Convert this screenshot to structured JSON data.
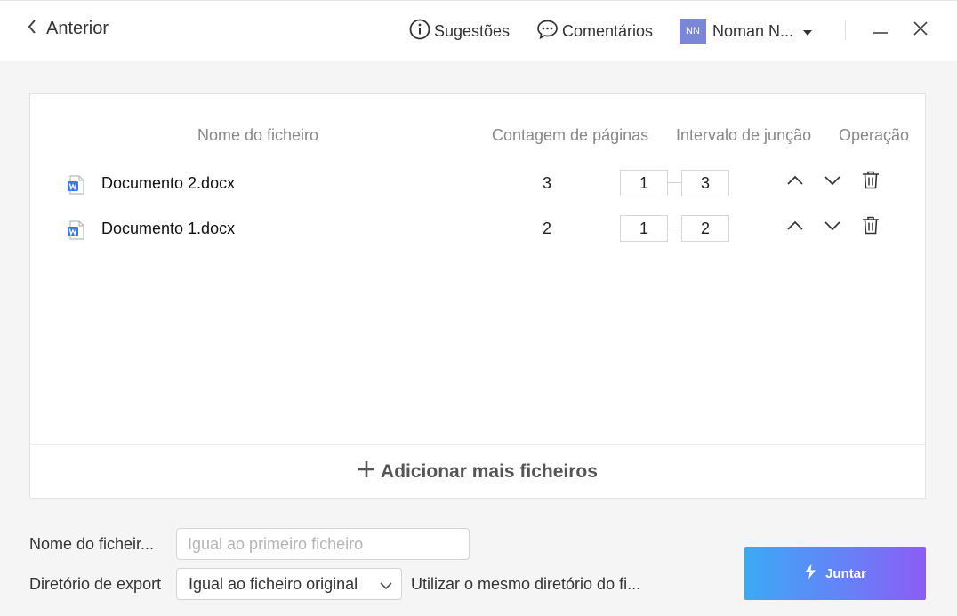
{
  "header": {
    "back_label": "Anterior",
    "suggestions_label": "Sugestões",
    "comments_label": "Comentários",
    "user_initials": "NN",
    "user_name": "Noman N...",
    "colors": {
      "avatar": "#7b86d6"
    }
  },
  "table": {
    "columns": [
      "Nome do ficheiro",
      "Contagem de páginas",
      "Intervalo de junção",
      "Operação"
    ],
    "rows": [
      {
        "name": "Documento 2.docx",
        "pages": "3",
        "from": "1",
        "to": "3"
      },
      {
        "name": "Documento 1.docx",
        "pages": "2",
        "from": "1",
        "to": "2"
      }
    ],
    "add_more_label": "Adicionar mais ficheiros"
  },
  "form": {
    "filename_label": "Nome do ficheir...",
    "filename_placeholder": "Igual ao primeiro ficheiro",
    "filename_value": "",
    "dir_label": "Diretório de export",
    "dir_value": "Igual ao ficheiro original",
    "dir_hint": "Utilizar o mesmo diretório do fi..."
  },
  "merge_button": {
    "label": "Juntar",
    "colors": {
      "from": "#3ba9f5",
      "to": "#8b5cf6"
    }
  },
  "icons": {
    "back": "chevron-left-icon",
    "suggestions": "info-circle-icon",
    "comments": "chat-bubble-icon",
    "user_menu": "caret-down-icon",
    "minimize": "minimize-icon",
    "close": "close-icon",
    "file": "word-document-icon",
    "move_up": "chevron-up-icon",
    "move_down": "chevron-down-icon",
    "delete": "trash-icon",
    "add": "plus-icon",
    "select": "chevron-down-icon",
    "merge": "lightning-icon"
  }
}
